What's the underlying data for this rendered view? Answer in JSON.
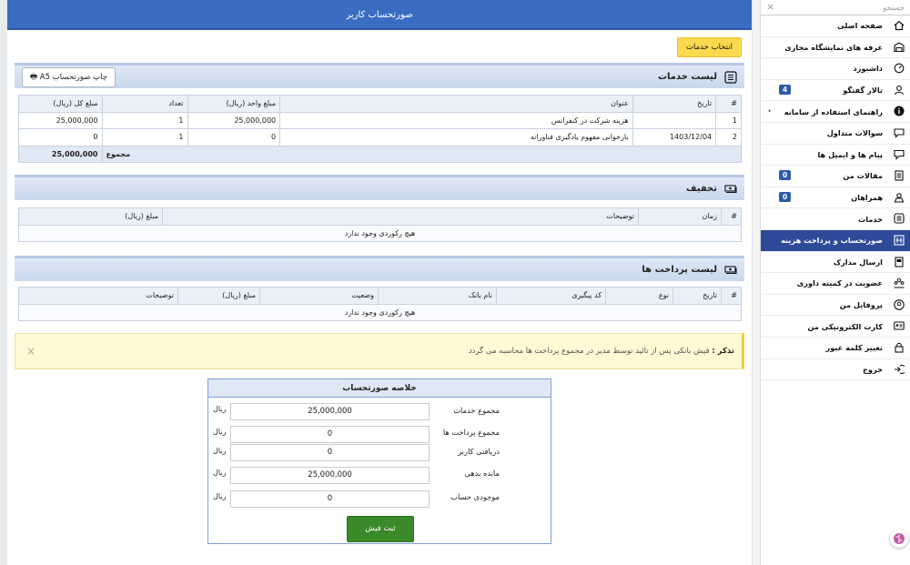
{
  "header": {
    "title": "صورتحساب کاربر"
  },
  "actions": {
    "select_services": "انتخاب خدمات",
    "print_invoice": "چاپ صورتحساب A5"
  },
  "services": {
    "title": "لیست خدمات",
    "columns": [
      "#",
      "تاریخ",
      "عنوان",
      "مبلغ واحد (ریال)",
      "تعداد",
      "مبلغ کل (ریال)"
    ],
    "rows": [
      {
        "num": "1",
        "date": "",
        "title": "هزینه شرکت در کنفرانس",
        "unit_price": "25,000,000",
        "qty": "1",
        "total": "25,000,000"
      },
      {
        "num": "2",
        "date": "1403/12/04",
        "title": "بازخوانی مفهوم یادگیری فناورانه",
        "unit_price": "0",
        "qty": "1",
        "total": "0"
      }
    ],
    "sum_label": "مجموع",
    "sum_value": "25,000,000"
  },
  "discount": {
    "title": "تخفیف",
    "columns": [
      "#",
      "زمان",
      "توضیحات",
      "مبلغ (ریال)"
    ],
    "empty": "هیچ رکوردی وجود ندارد"
  },
  "payments": {
    "title": "لیست پرداخت ها",
    "columns": [
      "#",
      "تاریخ",
      "نوع",
      "کد پیگیری",
      "نام بانک",
      "وضعیت",
      "مبلغ (ریال)",
      "توضیحات"
    ],
    "empty": "هیچ رکوردی وجود ندارد"
  },
  "alert": {
    "label": "تذکر :",
    "text": "فیش بانکی پس از تائید توسط مدیر در مجموع پرداخت ها محاسبه می گردد",
    "close": "×"
  },
  "summary": {
    "title": "خلاصه صورتحساب",
    "unit": "ریال",
    "services_total_label": "مجموع خدمات",
    "services_total": "25,000,000",
    "payments_total_label": "مجموع پرداخت ها",
    "received_label": "دریافتی کاربر",
    "payments_total": "0",
    "received": "0",
    "debt_label": "مانده بدهی",
    "debt": "25,000,000",
    "balance_label": "موجودی حساب",
    "balance": "0",
    "submit": "ثبت فیش"
  },
  "sidebar": {
    "search_placeholder": "جستجو",
    "items": [
      {
        "label": "صفحه اصلی",
        "icon": "home-icon"
      },
      {
        "label": "غرفه های نمایشگاه مجازی",
        "icon": "booth-icon"
      },
      {
        "label": "داشبورد",
        "icon": "dashboard-icon"
      },
      {
        "label": "تالار گفتگو",
        "icon": "forum-icon",
        "badge": "4"
      },
      {
        "label": "راهنمای استفاده از سامانه",
        "icon": "info-icon"
      },
      {
        "label": "سوالات متداول",
        "icon": "faq-icon"
      },
      {
        "label": "پیام ها و ایمیل ها",
        "icon": "messages-icon"
      },
      {
        "label": "مقالات من",
        "icon": "articles-icon",
        "badge": "0"
      },
      {
        "label": "همراهان",
        "icon": "companions-icon",
        "badge": "0"
      },
      {
        "label": "خدمات",
        "icon": "services-icon"
      },
      {
        "label": "صورتحساب و پرداخت هزینه",
        "icon": "invoice-icon"
      },
      {
        "label": "ارسال مدارک",
        "icon": "documents-icon"
      },
      {
        "label": "عضویت در کمیته داوری",
        "icon": "committee-icon"
      },
      {
        "label": "پروفایل من",
        "icon": "profile-icon"
      },
      {
        "label": "کارت الکترونیکی من",
        "icon": "card-icon"
      },
      {
        "label": "تغییر کلمه عبور",
        "icon": "password-icon"
      },
      {
        "label": "خروج",
        "icon": "logout-icon"
      }
    ]
  },
  "colors": {
    "accent": "#3a6dc1",
    "active_nav": "#2f4a98",
    "submit": "#3a8a2a",
    "select_button": "#fcd94e"
  }
}
